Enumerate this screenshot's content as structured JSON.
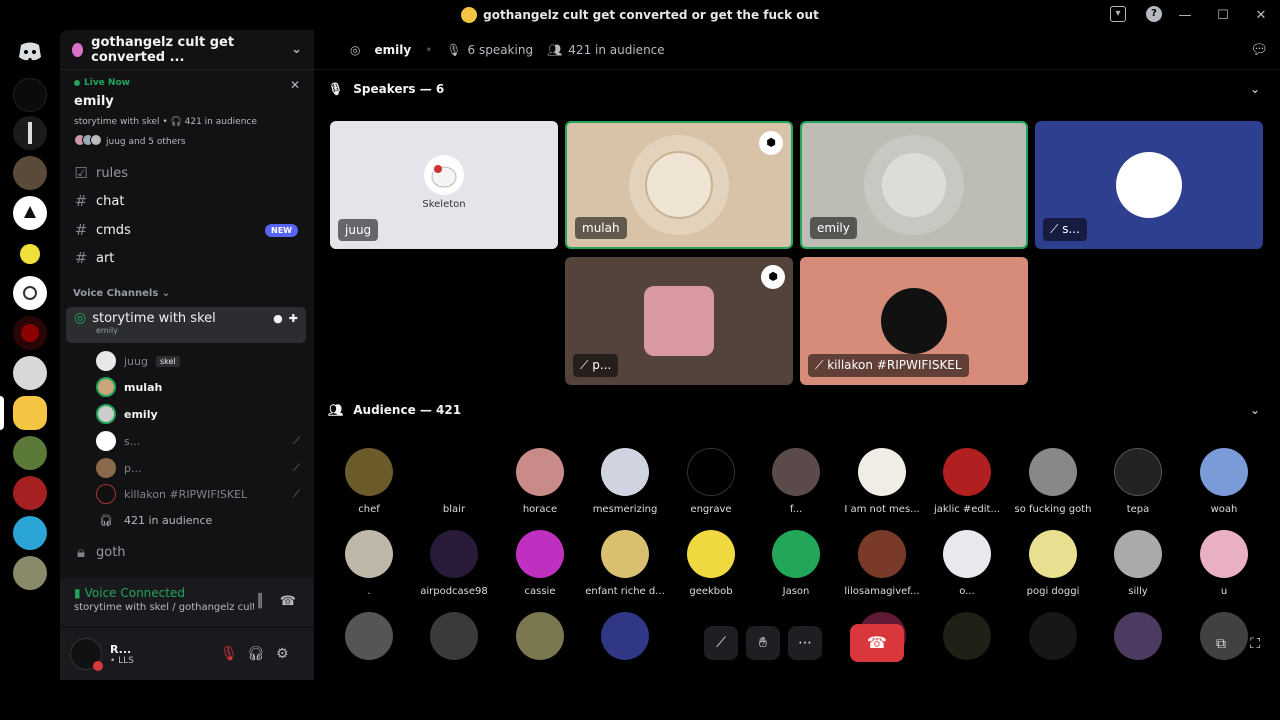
{
  "window": {
    "title": "gothangelz cult get converted or get the fuck out"
  },
  "sidebar": {
    "guild_name": "gothangelz cult get converted ...",
    "live": {
      "label": "Live Now",
      "stage_name": "emily",
      "topic_line": "storytime with skel • 🎧 421 in audience",
      "speakers_line": "juug and 5 others"
    },
    "text_channels": [
      {
        "name": "rules",
        "icon": "checkbox-icon"
      },
      {
        "name": "chat",
        "icon": "hash-icon"
      },
      {
        "name": "cmds",
        "icon": "hash-icon",
        "badge": "NEW"
      },
      {
        "name": "art",
        "icon": "hash-icon"
      }
    ],
    "voice_header": "Voice Channels",
    "voice_channel": {
      "name": "storytime with skel",
      "subtitle": "emily"
    },
    "voice_users": [
      {
        "name": "juug",
        "tag": "skel"
      },
      {
        "name": "mulah"
      },
      {
        "name": "emily"
      },
      {
        "name": "s..."
      },
      {
        "name": "p..."
      },
      {
        "name": "killakon #RIPWIFISKEL"
      }
    ],
    "audience_line": "421 in audience",
    "locked_channel": "goth",
    "voice_connected": {
      "status": "Voice Connected",
      "location": "storytime with skel / gothangelz cult get c..."
    },
    "user": {
      "name": "R...",
      "status": "• LLS"
    }
  },
  "main": {
    "header": {
      "stage": "emily",
      "speaking": "6 speaking",
      "audience": "421 in audience"
    },
    "speakers_label": "Speakers — 6",
    "speakers": [
      {
        "name": "juug",
        "inner_text": "Skeleton",
        "bg": "#e3e5ea"
      },
      {
        "name": "mulah",
        "bg": "#d9c3a8",
        "moderator": true
      },
      {
        "name": "emily",
        "bg": "#bdbdb6"
      },
      {
        "name": "s...",
        "bg": "#2f3f8f"
      },
      {
        "name": "p...",
        "bg": "#54433b",
        "moderator": true
      },
      {
        "name": "killakon #RIPWIFISKEL",
        "bg": "#d68c78"
      }
    ],
    "audience_label": "Audience — 421",
    "audience_row1": [
      "chef",
      "blair",
      "horace",
      "mesmerizing",
      "engrave",
      "f...",
      "I am not mes...",
      "jaklic #edit...",
      "so fucking goth",
      "tepa",
      "woah"
    ],
    "audience_row2": [
      ".",
      "airpodcase98",
      "cassie",
      "enfant riche d...",
      "geekbob",
      "Jason",
      "lilosamagivef...",
      "o...",
      "pogi doggi",
      "silly",
      "u"
    ]
  },
  "colors": {
    "green": "#23a55a",
    "blurple": "#5865f2",
    "red": "#da373c"
  }
}
